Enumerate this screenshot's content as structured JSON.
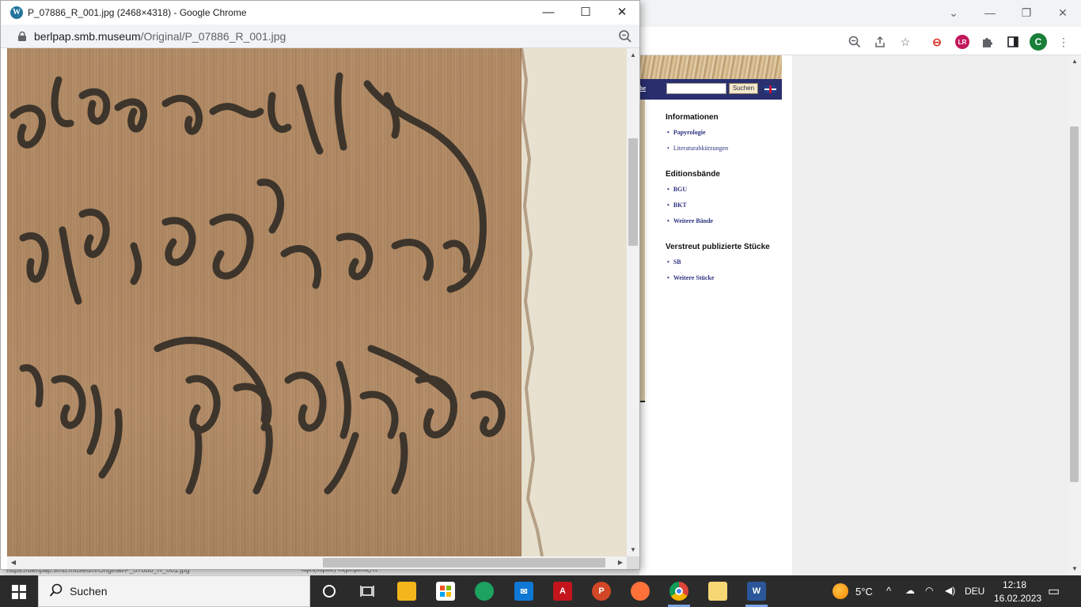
{
  "popup": {
    "title": "P_07886_R_001.jpg (2468×4318) - Google Chrome",
    "url_domain": "berlpap.smb.museum",
    "url_path": "/Original/P_07886_R_001.jpg"
  },
  "site": {
    "nav_link": "he",
    "search_button": "Suchen",
    "sections": [
      {
        "heading": "Informationen",
        "items": [
          {
            "label": "Papyrologie",
            "bold": true
          },
          {
            "label": "Literaturabkürzungen",
            "bold": false
          }
        ]
      },
      {
        "heading": "Editionsbände",
        "items": [
          {
            "label": "BGU",
            "bold": true
          },
          {
            "label": "BKT",
            "bold": true
          },
          {
            "label": "Weitere Bände",
            "bold": true
          }
        ]
      },
      {
        "heading": "Verstreut publizierte Stücke",
        "items": [
          {
            "label": "SB",
            "bold": true
          },
          {
            "label": "Weitere Stücke",
            "bold": true
          }
        ]
      }
    ],
    "status_url": "https://berlpap.smb.museum/Original/P_07886_R_001.jpg",
    "under_text": "ταρει(λαρίου) νο(μίσματος) εε"
  },
  "taskbar": {
    "search_placeholder": "Suchen",
    "weather": "5°C",
    "language": "DEU",
    "time": "12:18",
    "date": "16.02.2023"
  },
  "colors": {
    "site_nav": "#2a2f6e",
    "link": "#2f3580",
    "taskbar": "#2b2b2b"
  }
}
